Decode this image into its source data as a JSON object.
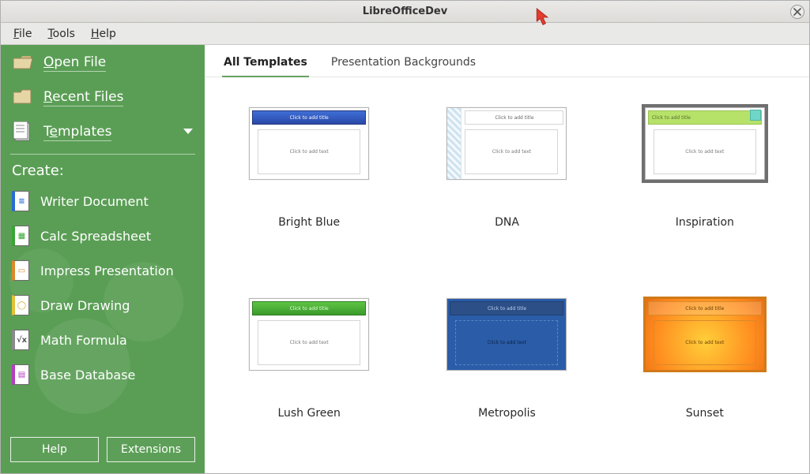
{
  "window": {
    "title": "LibreOfficeDev"
  },
  "menu": {
    "file": "File",
    "tools": "Tools",
    "help": "Help"
  },
  "sidebar": {
    "open": "Open File",
    "recent": "Recent Files",
    "templates": "Templates",
    "create_heading": "Create:",
    "writer": "Writer Document",
    "calc": "Calc Spreadsheet",
    "impress": "Impress Presentation",
    "draw": "Draw Drawing",
    "math": "Math Formula",
    "base": "Base Database",
    "help_btn": "Help",
    "ext_btn": "Extensions"
  },
  "tabs": {
    "all": "All Templates",
    "bg": "Presentation Backgrounds"
  },
  "templates": {
    "t0": {
      "title": "Click to add title",
      "body": "Click to add text",
      "caption": "Bright Blue"
    },
    "t1": {
      "title": "Click to add title",
      "body": "Click to add text",
      "caption": "DNA"
    },
    "t2": {
      "title": "Click to add title",
      "body": "Click to add text",
      "caption": "Inspiration"
    },
    "t3": {
      "title": "Click to add title",
      "body": "Click to add text",
      "caption": "Lush Green"
    },
    "t4": {
      "title": "Click to add title",
      "body": "Click to add text",
      "caption": "Metropolis"
    },
    "t5": {
      "title": "Click to add title",
      "body": "Click to add text",
      "caption": "Sunset"
    }
  }
}
